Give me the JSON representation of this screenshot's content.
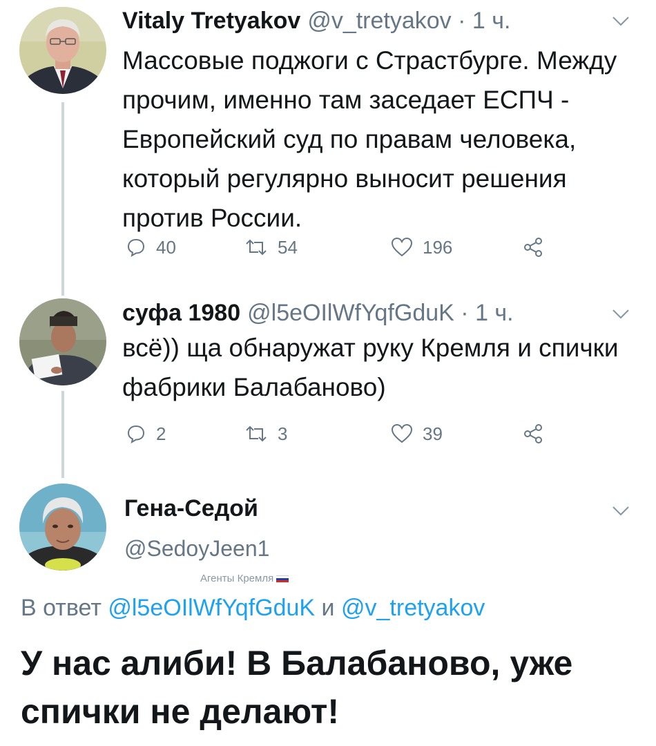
{
  "tweets": [
    {
      "name": "Vitaly Tretyakov",
      "handle": "@v_tretyakov",
      "time": "1 ч.",
      "text": "Массовые поджоги с Страстбурге. Между прочим, именно там заседает ЕСПЧ - Европейский суд по правам человека, который регулярно выносит решения против России.",
      "replies": "40",
      "retweets": "54",
      "likes": "196"
    },
    {
      "name": "суфа 1980",
      "handle": "@l5eOIlWfYqfGduK",
      "time": "1 ч.",
      "text": "всё)) ща обнаружат руку Кремля и спички фабрики Балабаново)",
      "replies": "2",
      "retweets": "3",
      "likes": "39"
    }
  ],
  "main_tweet": {
    "name": "Гена-Седой",
    "handle": "@SedoyJeen1",
    "tag": "Агенты Кремля",
    "reply_prefix": "В ответ",
    "reply_mention_1": "@l5eOIlWfYqfGduK",
    "reply_and": "и",
    "reply_mention_2": "@v_tretyakov",
    "text": "У нас алиби! В Балабаново, уже спички не делают!"
  },
  "icons": {
    "reply": "reply-icon",
    "retweet": "retweet-icon",
    "like": "heart-icon",
    "share": "share-icon",
    "menu": "chevron-down-icon"
  },
  "colors": {
    "text": "#14171a",
    "secondary": "#657786",
    "link": "#1da1f2",
    "thread_line": "#ccd6dd"
  }
}
